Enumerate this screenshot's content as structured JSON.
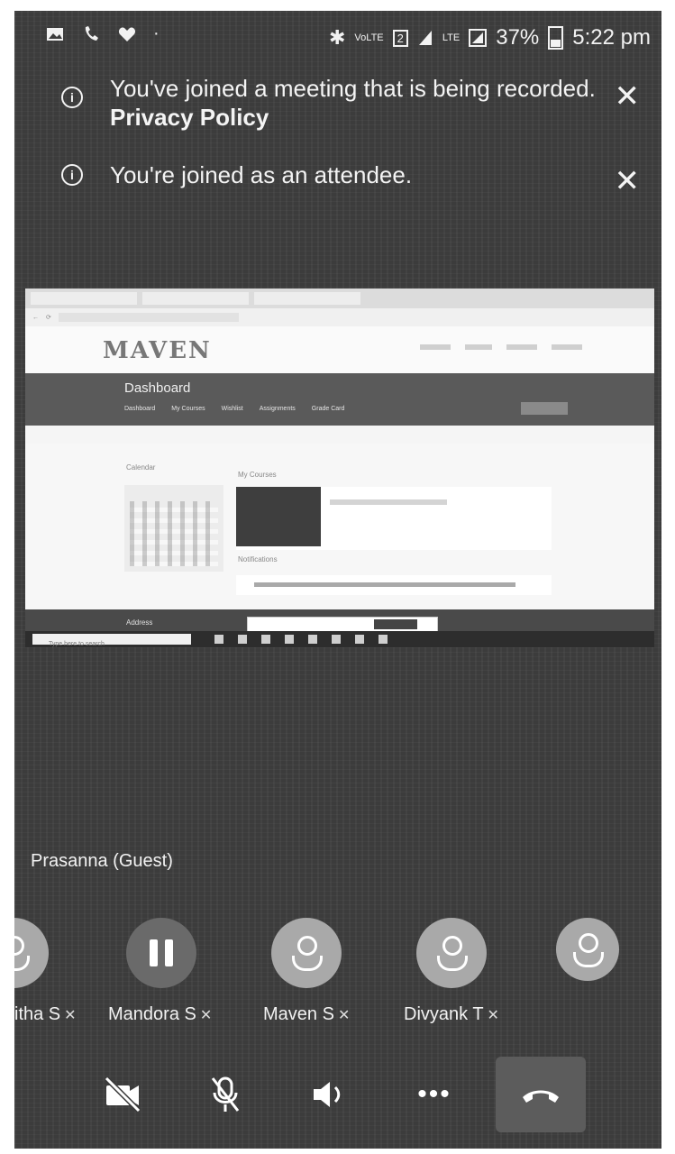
{
  "status_bar": {
    "left_icons": [
      "gallery-icon",
      "phone-icon",
      "heart-icon",
      "dot-icon"
    ],
    "volte": "VoLTE",
    "sim": "2",
    "lte": "LTE",
    "battery": "37%",
    "time": "5:22 pm"
  },
  "notifications": [
    {
      "message": "You've joined a meeting that is being recorded.",
      "link": "Privacy Policy"
    },
    {
      "message": "You're joined as an attendee."
    }
  ],
  "shared_screen": {
    "site_logo": "MAVEN",
    "page_title": "Dashboard",
    "tabs": [
      "Dashboard",
      "My Courses",
      "Wishlist",
      "Assignments",
      "Grade Card"
    ],
    "calendar_label": "Calendar",
    "courses_label": "My Courses",
    "notifications_label": "Notifications",
    "address_label": "Address",
    "taskbar_search": "Type here to search"
  },
  "speaker": "Prasanna (Guest)",
  "participants": [
    {
      "name": "itha S",
      "avatar": "person-icon",
      "muted": true
    },
    {
      "name": "Mandora S",
      "avatar": "pause-icon",
      "muted": true
    },
    {
      "name": "Maven S",
      "avatar": "person-icon",
      "muted": true
    },
    {
      "name": "Divyank T",
      "avatar": "person-icon",
      "muted": true
    },
    {
      "name": "",
      "avatar": "person-icon",
      "muted": false
    }
  ],
  "controls": [
    "camera-off-icon",
    "mic-off-icon",
    "speaker-icon",
    "more-icon",
    "hang-up-icon"
  ],
  "colors": {
    "background": "#3c3c3c",
    "avatar": "#a9a9a9",
    "text": "#f2f2f2"
  }
}
